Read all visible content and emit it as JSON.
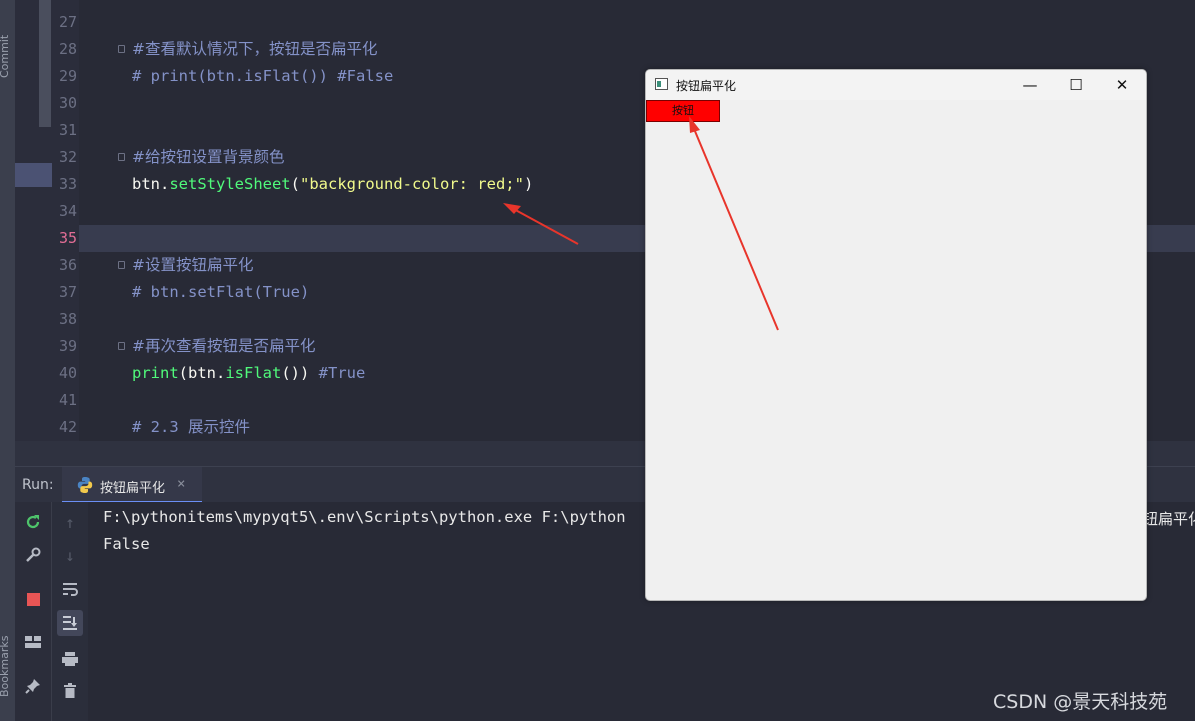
{
  "side_panels": {
    "commit_label": "Commit",
    "bookmarks_label": "Bookmarks"
  },
  "editor": {
    "lines": [
      {
        "num": "27",
        "tokens": []
      },
      {
        "num": "28",
        "tokens": [
          {
            "t": "#查看默认情况下，按钮是否扁平化",
            "c": "cmt cn"
          }
        ]
      },
      {
        "num": "29",
        "tokens": [
          {
            "t": "# print(btn.isFlat()) #False",
            "c": "cmt"
          }
        ]
      },
      {
        "num": "30",
        "tokens": []
      },
      {
        "num": "31",
        "tokens": []
      },
      {
        "num": "32",
        "tokens": [
          {
            "t": "#给按钮设置背景颜色",
            "c": "cmt cn"
          }
        ]
      },
      {
        "num": "33",
        "tokens": [
          {
            "t": "btn.",
            "c": "plain"
          },
          {
            "t": "setStyleSheet",
            "c": "fn"
          },
          {
            "t": "(",
            "c": "plain"
          },
          {
            "t": "\"background-color: red;\"",
            "c": "str"
          },
          {
            "t": ")",
            "c": "plain"
          }
        ]
      },
      {
        "num": "34",
        "tokens": []
      },
      {
        "num": "35",
        "tokens": [],
        "active": true
      },
      {
        "num": "36",
        "tokens": [
          {
            "t": "#设置按钮扁平化",
            "c": "cmt cn"
          }
        ]
      },
      {
        "num": "37",
        "tokens": [
          {
            "t": "# btn.setFlat(True)",
            "c": "cmt"
          }
        ]
      },
      {
        "num": "38",
        "tokens": []
      },
      {
        "num": "39",
        "tokens": [
          {
            "t": "#再次查看按钮是否扁平化",
            "c": "cmt cn"
          }
        ]
      },
      {
        "num": "40",
        "tokens": [
          {
            "t": "print",
            "c": "fn"
          },
          {
            "t": "(btn.",
            "c": "plain"
          },
          {
            "t": "isFlat",
            "c": "fn"
          },
          {
            "t": "()) ",
            "c": "plain"
          },
          {
            "t": "#True",
            "c": "cmt"
          }
        ]
      },
      {
        "num": "41",
        "tokens": []
      },
      {
        "num": "42",
        "tokens": [
          {
            "t": "# 2.3 展示控件",
            "c": "cmt"
          }
        ]
      }
    ]
  },
  "run": {
    "label": "Run:",
    "tab_label": "按钮扁平化",
    "close_glyph": "×",
    "console": [
      "F:\\pythonitems\\mypyqt5\\.env\\Scripts\\python.exe F:\\python",
      "False"
    ],
    "console_overflow_text": "钮扁平化"
  },
  "qt_window": {
    "title": "按钮扁平化",
    "minimize_glyph": "—",
    "maximize_glyph": "☐",
    "close_glyph": "✕",
    "button_label": "按钮",
    "button_color": "#ff0000"
  },
  "annotation": {
    "arrow_color": "#e8352b"
  },
  "watermark": "CSDN @景天科技苑"
}
